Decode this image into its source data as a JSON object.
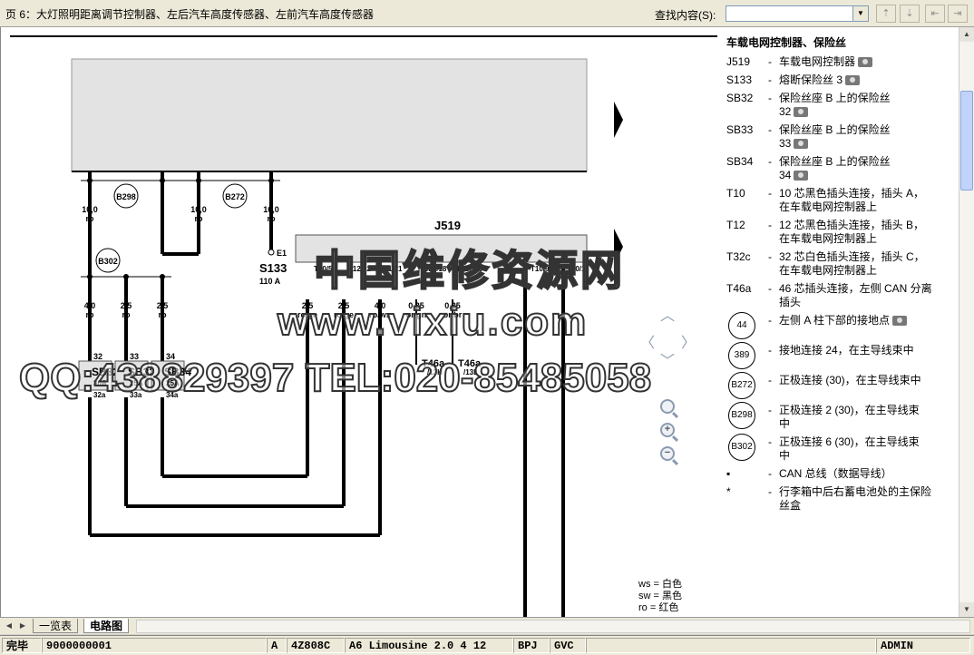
{
  "header": {
    "title": "页 6：大灯照明距离调节控制器、左后汽车高度传感器、左前汽车高度传感器",
    "search_label": "查找内容(S):",
    "search_value": ""
  },
  "legend": {
    "heading": "车载电网控制器、保险丝",
    "items": [
      {
        "code": "J519",
        "text": "车载电网控制器",
        "photo": true
      },
      {
        "code": "S133",
        "text": "熔断保险丝 3",
        "photo": true
      },
      {
        "code": "SB32",
        "text": "保险丝座 B 上的保险丝",
        "text2": "32",
        "photo": true
      },
      {
        "code": "SB33",
        "text": "保险丝座 B 上的保险丝",
        "text2": "33",
        "photo": true
      },
      {
        "code": "SB34",
        "text": "保险丝座 B 上的保险丝",
        "text2": "34",
        "photo": true
      },
      {
        "code": "T10",
        "text": "10 芯黑色插头连接，插头 A，",
        "text2": "在车载电网控制器上"
      },
      {
        "code": "T12",
        "text": "12 芯黑色插头连接，插头 B，",
        "text2": "在车载电网控制器上"
      },
      {
        "code": "T32c",
        "text": "32 芯白色插头连接，插头 C，",
        "text2": "在车载电网控制器上"
      },
      {
        "code": "T46a",
        "text": "46 芯插头连接，左侧 CAN 分离",
        "text2": "插头"
      }
    ],
    "circle_items": [
      {
        "code": "44",
        "text": "左侧 A 柱下部的接地点",
        "photo": true
      },
      {
        "code": "389",
        "text": "接地连接 24，在主导线束中"
      },
      {
        "code": "B272",
        "text": "正极连接 (30)，在主导线束中"
      },
      {
        "code": "B298",
        "text": "正极连接 2 (30)，在主导线束",
        "text2": "中"
      },
      {
        "code": "B302",
        "text": "正极连接 6 (30)，在主导线束",
        "text2": "中"
      }
    ],
    "notes": [
      {
        "code": "▪",
        "text": "CAN 总线（数据导线）"
      },
      {
        "code": "*",
        "text": "行李箱中后右蓄电池处的主保险",
        "text2": "丝盒"
      }
    ]
  },
  "color_key": [
    {
      "code": "ws",
      "text": "= 白色"
    },
    {
      "code": "sw",
      "text": "= 黑色"
    },
    {
      "code": "ro",
      "text": "= 红色"
    }
  ],
  "diagram": {
    "j519_label": "J519",
    "s133_label": "S133",
    "s133_rating": "110 A",
    "e1_label": "E1",
    "connectors": [
      "B298",
      "B272",
      "B302"
    ],
    "top_wires": [
      {
        "gauge": "10,0",
        "color": "ro"
      },
      {
        "gauge": "10,0",
        "color": "ro"
      },
      {
        "gauge": "16,0",
        "color": "ro"
      }
    ],
    "mid_wires": [
      {
        "gauge": "4,0",
        "color": "ro"
      },
      {
        "gauge": "2,5",
        "color": "ro"
      },
      {
        "gauge": "2,5",
        "color": "ro"
      }
    ],
    "j_wires": [
      {
        "gauge": "2,5",
        "color": "ro/ge"
      },
      {
        "gauge": "2,5",
        "color": "ro/ge"
      },
      {
        "gauge": "4,0",
        "color": "ro/ws"
      },
      {
        "gauge": "0,35",
        "color": "or/gn"
      },
      {
        "gauge": "0,35",
        "color": "or/br"
      }
    ],
    "pins": [
      "T10/5",
      "T12/12",
      "T12/1",
      "T32c/18",
      "T32c/19",
      "T10/9",
      "T10/1"
    ],
    "fuses": [
      {
        "top": "32",
        "label": "SB32",
        "rating": "30A",
        "bottom": "32a"
      },
      {
        "top": "33",
        "label": "SB33",
        "rating": "25A",
        "bottom": "33a"
      },
      {
        "top": "34",
        "label": "SB34",
        "rating": "25A",
        "bottom": "34a"
      }
    ],
    "t46_left": "T46a",
    "t46_left_pin": "/13H",
    "t46_right": "T46a",
    "t46_right_pin": "/13L",
    "watermark_name": "中国维修资源网",
    "watermark_url": "www.vixiu.com",
    "watermark_contact": "QQ:438829397 TEL:020-85485058"
  },
  "tabs": [
    {
      "label": "一览表"
    },
    {
      "label": "电路图"
    }
  ],
  "status": {
    "state": "完毕",
    "code": "9000000001",
    "letter": "A",
    "part": "4Z808C",
    "model": "A6 Limousine 2.0 4 12",
    "engine": "BPJ",
    "gearbox": "GVC",
    "user": "ADMIN"
  }
}
